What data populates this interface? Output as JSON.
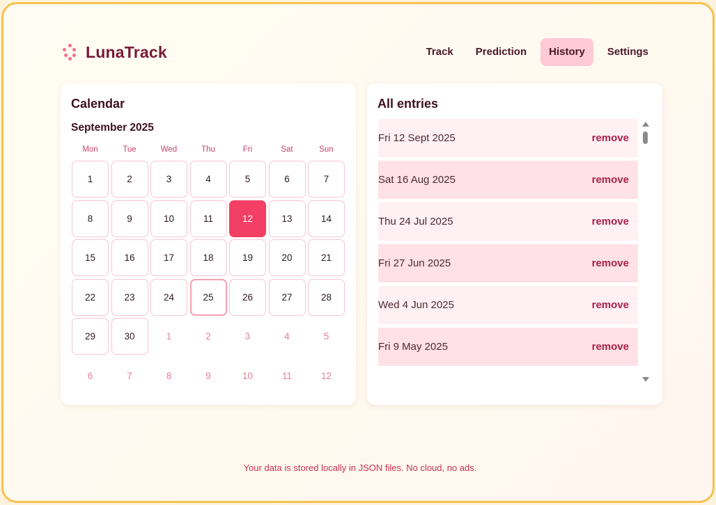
{
  "app": {
    "name": "LunaTrack"
  },
  "nav": {
    "items": [
      "Track",
      "Prediction",
      "History",
      "Settings"
    ],
    "active": "History"
  },
  "calendar": {
    "title": "Calendar",
    "month_label": "September 2025",
    "weekdays": [
      "Mon",
      "Tue",
      "Wed",
      "Thu",
      "Fri",
      "Sat",
      "Sun"
    ],
    "selected_day": 12,
    "today": 25,
    "days": [
      {
        "d": "1",
        "m": false
      },
      {
        "d": "2",
        "m": false
      },
      {
        "d": "3",
        "m": false
      },
      {
        "d": "4",
        "m": false
      },
      {
        "d": "5",
        "m": false
      },
      {
        "d": "6",
        "m": false
      },
      {
        "d": "7",
        "m": false
      },
      {
        "d": "8",
        "m": false
      },
      {
        "d": "9",
        "m": false
      },
      {
        "d": "10",
        "m": false
      },
      {
        "d": "11",
        "m": false
      },
      {
        "d": "12",
        "m": false
      },
      {
        "d": "13",
        "m": false
      },
      {
        "d": "14",
        "m": false
      },
      {
        "d": "15",
        "m": false
      },
      {
        "d": "16",
        "m": false
      },
      {
        "d": "17",
        "m": false
      },
      {
        "d": "18",
        "m": false
      },
      {
        "d": "19",
        "m": false
      },
      {
        "d": "20",
        "m": false
      },
      {
        "d": "21",
        "m": false
      },
      {
        "d": "22",
        "m": false
      },
      {
        "d": "23",
        "m": false
      },
      {
        "d": "24",
        "m": false
      },
      {
        "d": "25",
        "m": false
      },
      {
        "d": "26",
        "m": false
      },
      {
        "d": "27",
        "m": false
      },
      {
        "d": "28",
        "m": false
      },
      {
        "d": "29",
        "m": false
      },
      {
        "d": "30",
        "m": false
      },
      {
        "d": "1",
        "m": true
      },
      {
        "d": "2",
        "m": true
      },
      {
        "d": "3",
        "m": true
      },
      {
        "d": "4",
        "m": true
      },
      {
        "d": "5",
        "m": true
      },
      {
        "d": "6",
        "m": true
      },
      {
        "d": "7",
        "m": true
      },
      {
        "d": "8",
        "m": true
      },
      {
        "d": "9",
        "m": true
      },
      {
        "d": "10",
        "m": true
      },
      {
        "d": "11",
        "m": true
      },
      {
        "d": "12",
        "m": true
      }
    ]
  },
  "entries": {
    "title": "All entries",
    "remove_label": "remove",
    "items": [
      "Fri 12 Sept 2025",
      "Sat 16 Aug 2025",
      "Thu 24 Jul 2025",
      "Fri 27 Jun 2025",
      "Wed 4 Jun 2025",
      "Fri 9 May 2025"
    ]
  },
  "footer": {
    "text": "Your data is stored locally in JSON files. No cloud, no ads."
  },
  "colors": {
    "accent": "#f43f65",
    "brand": "#7a1a36",
    "frame": "#f6c14f",
    "nav_active": "#ffcad5"
  }
}
